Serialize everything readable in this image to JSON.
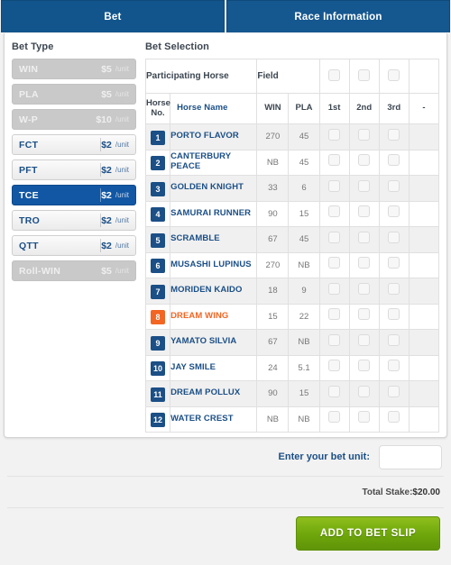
{
  "tabs": [
    {
      "label": "Bet",
      "active": true
    },
    {
      "label": "Race Information",
      "active": false
    }
  ],
  "bet_type": {
    "section_label": "Bet Type",
    "unit_suffix": "/unit",
    "items": [
      {
        "code": "WIN",
        "price": "$5",
        "state": "disabled"
      },
      {
        "code": "PLA",
        "price": "$5",
        "state": "disabled"
      },
      {
        "code": "W-P",
        "price": "$10",
        "state": "disabled"
      },
      {
        "code": "FCT",
        "price": "$2",
        "state": "enabled"
      },
      {
        "code": "PFT",
        "price": "$2",
        "state": "enabled"
      },
      {
        "code": "TCE",
        "price": "$2",
        "state": "selected"
      },
      {
        "code": "TRO",
        "price": "$2",
        "state": "enabled"
      },
      {
        "code": "QTT",
        "price": "$2",
        "state": "enabled"
      },
      {
        "code": "Roll-WIN",
        "price": "$5",
        "state": "disabled"
      }
    ]
  },
  "bet_selection": {
    "section_label": "Bet Selection",
    "field_header": {
      "participating_horse": "Participating Horse",
      "field": "Field"
    },
    "columns": {
      "horse_no": "Horse No.",
      "horse_name": "Horse Name",
      "win": "WIN",
      "pla": "PLA",
      "first": "1st",
      "second": "2nd",
      "third": "3rd",
      "last": "-"
    },
    "rows": [
      {
        "no": "1",
        "name": "PORTO FLAVOR",
        "win": "270",
        "pla": "45",
        "highlight": false
      },
      {
        "no": "2",
        "name": "CANTERBURY PEACE",
        "win": "NB",
        "pla": "45",
        "highlight": false
      },
      {
        "no": "3",
        "name": "GOLDEN KNIGHT",
        "win": "33",
        "pla": "6",
        "highlight": false
      },
      {
        "no": "4",
        "name": "SAMURAI RUNNER",
        "win": "90",
        "pla": "15",
        "highlight": false
      },
      {
        "no": "5",
        "name": "SCRAMBLE",
        "win": "67",
        "pla": "45",
        "highlight": false
      },
      {
        "no": "6",
        "name": "MUSASHI LUPINUS",
        "win": "270",
        "pla": "NB",
        "highlight": false
      },
      {
        "no": "7",
        "name": "MORIDEN KAIDO",
        "win": "18",
        "pla": "9",
        "highlight": false
      },
      {
        "no": "8",
        "name": "DREAM WING",
        "win": "15",
        "pla": "22",
        "highlight": true
      },
      {
        "no": "9",
        "name": "YAMATO SILVIA",
        "win": "67",
        "pla": "NB",
        "highlight": false
      },
      {
        "no": "10",
        "name": "JAY SMILE",
        "win": "24",
        "pla": "5.1",
        "highlight": false
      },
      {
        "no": "11",
        "name": "DREAM POLLUX",
        "win": "90",
        "pla": "15",
        "highlight": false
      },
      {
        "no": "12",
        "name": "WATER CREST",
        "win": "NB",
        "pla": "NB",
        "highlight": false
      }
    ]
  },
  "footer": {
    "unit_label": "Enter your bet unit:",
    "unit_value": "",
    "unit_placeholder": "",
    "total_stake_label": "Total Stake:",
    "total_stake_value": "$20.00",
    "add_button": "ADD TO BET SLIP"
  },
  "colors": {
    "tab_blue": "#12558c",
    "selected_blue": "#1257a4",
    "navy_text": "#1b4f86",
    "highlight_orange": "#f26522",
    "green_button": "#6fa70b"
  }
}
